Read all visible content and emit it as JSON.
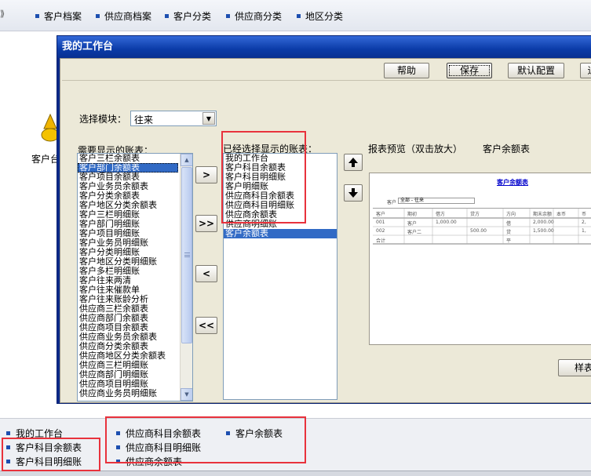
{
  "topnav": {
    "items": [
      "客户档案",
      "供应商档案",
      "客户分类",
      "供应商分类",
      "地区分类"
    ]
  },
  "desktop": {
    "icon_label": "客户台"
  },
  "dialog": {
    "title": "我的工作台",
    "buttons": {
      "help": "帮助",
      "save": "保存",
      "default_config": "默认配置",
      "exit_clipped": "退"
    },
    "module_label": "选择模块：",
    "module_value": "往来",
    "available_label": "需要显示的账表：",
    "selected_label": "已经选择显示的账表：",
    "preview_label": "报表预览（双击放大）",
    "preview_name": "客户余额表",
    "available_items": [
      "客户三栏余额表",
      "客户部门余额表",
      "客户项目余额表",
      "客户业务员余额表",
      "客户分类余额表",
      "客户地区分类余额表",
      "客户三栏明细账",
      "客户部门明细账",
      "客户项目明细账",
      "客户业务员明细账",
      "客户分类明细账",
      "客户地区分类明细账",
      "客户多栏明细账",
      "客户往来两清",
      "客户往来催款单",
      "客户往来账龄分析",
      "供应商三栏余额表",
      "供应商部门余额表",
      "供应商项目余额表",
      "供应商业务员余额表",
      "供应商分类余额表",
      "供应商地区分类余额表",
      "供应商三栏明细账",
      "供应商部门明细账",
      "供应商项目明细账",
      "供应商业务员明细账"
    ],
    "available_selected_index": 1,
    "selected_items": [
      "我的工作台",
      "客户科目余额表",
      "客户科目明细账",
      "客户明细账",
      "供应商科目余额表",
      "供应商科目明细账",
      "供应商余额表",
      "供应商明细账",
      "客户余额表"
    ],
    "selected_selected_index": 8,
    "move_buttons": {
      "add": ">",
      "add_all": ">>",
      "remove": "<",
      "remove_all": "<<"
    },
    "preview": {
      "title": "客户余额表",
      "filter_label": "客户",
      "filter_value": "全部 - 往来",
      "headers": [
        "客户",
        "期初",
        "借方",
        "贷方",
        "方向",
        "期末余额",
        "本币",
        "币"
      ],
      "rows": [
        [
          "001",
          "客户",
          "1,000.00",
          "",
          "借",
          "2,000.00",
          "",
          "2,"
        ],
        [
          "002",
          "客户二",
          "",
          "500.00",
          "贷",
          "1,500.00",
          "",
          "1,"
        ],
        [
          "合计",
          "",
          "",
          "",
          "平",
          "",
          "",
          ""
        ]
      ]
    },
    "sample_btn": "样表"
  },
  "bottom": {
    "col1": [
      "我的工作台",
      "客户科目余额表",
      "客户科目明细账"
    ],
    "col2": [
      "供应商科目余额表",
      "供应商科目明细账",
      "供应商余额表"
    ],
    "col3": [
      "客户余额表"
    ]
  },
  "colors": {
    "title_bar": "#0b3ba8",
    "selection": "#316ac5",
    "highlight_box": "#e8323c"
  }
}
